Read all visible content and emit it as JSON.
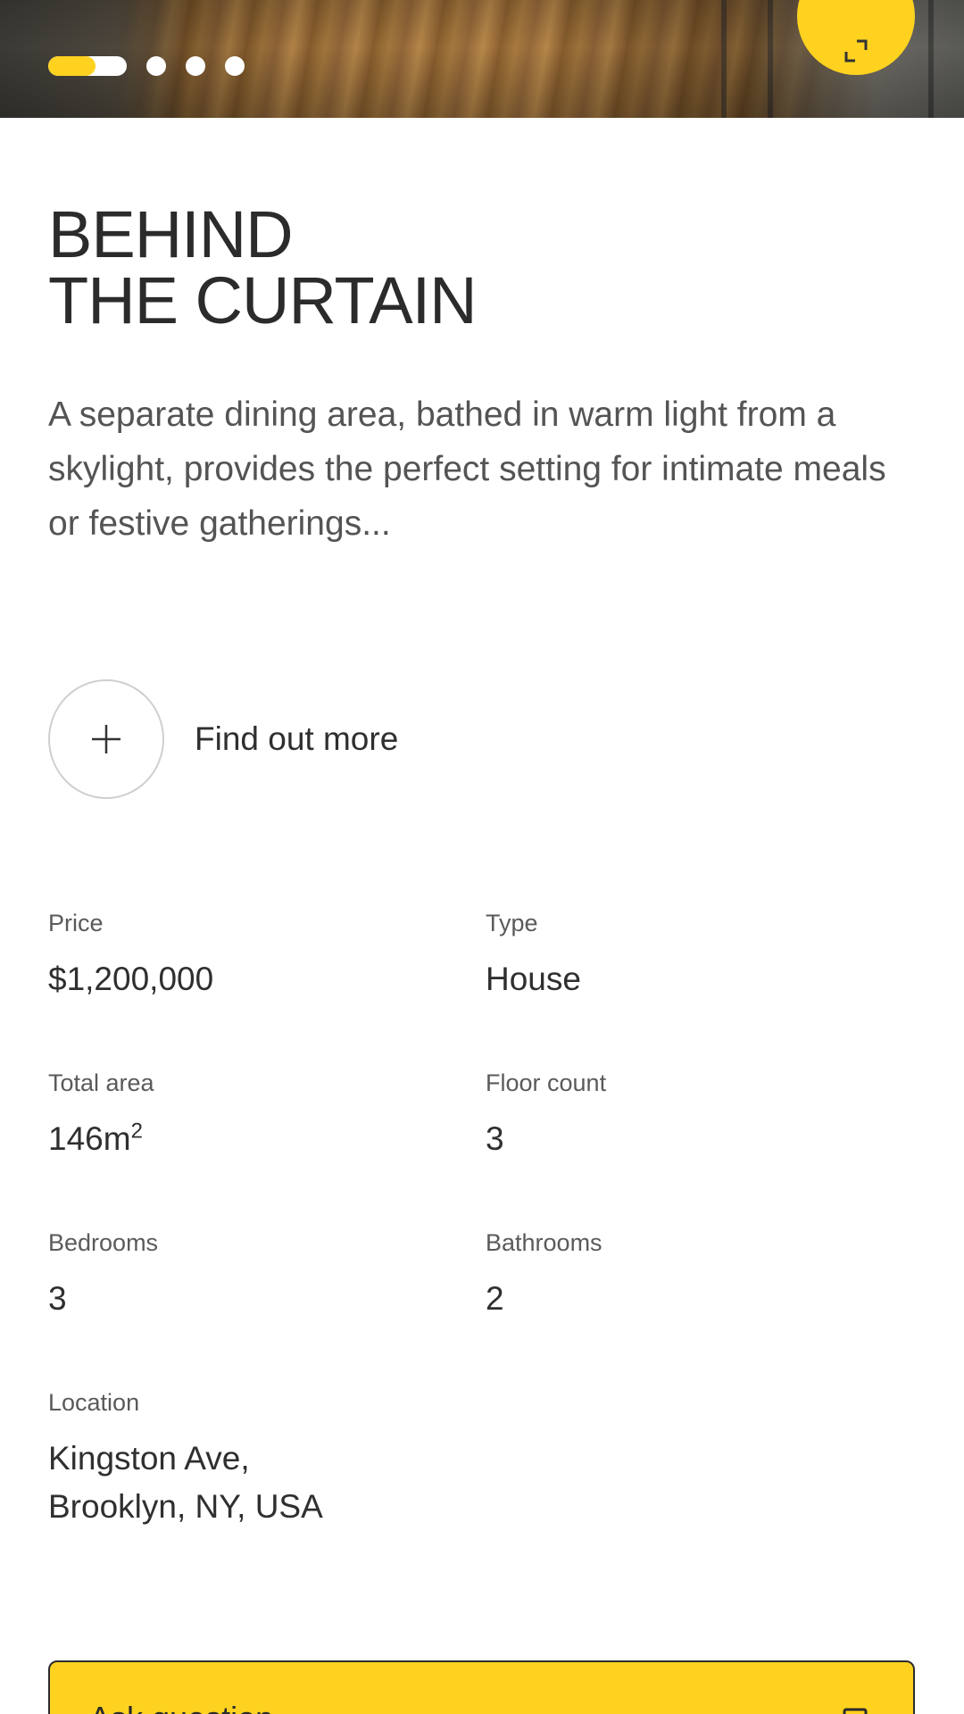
{
  "hero": {
    "carousel": {
      "total_slides": 4,
      "active_index": 0,
      "active_progress": 0.6
    },
    "expand_icon": "expand-icon",
    "accent_color": "#ffd21f"
  },
  "article": {
    "title_line1": "BEHIND",
    "title_line2": "THE CURTAIN",
    "description": "A separate dining area, bathed in warm light from a skylight, provides the perfect setting for intimate meals or festive gatherings..."
  },
  "find_more": {
    "icon": "plus-icon",
    "label": "Find out more"
  },
  "specs": {
    "price": {
      "label": "Price",
      "value": "$1,200,000"
    },
    "type": {
      "label": "Type",
      "value": "House"
    },
    "total_area": {
      "label": "Total area",
      "value": "146m",
      "unit_sup": "2"
    },
    "floor_count": {
      "label": "Floor count",
      "value": "3"
    },
    "bedrooms": {
      "label": "Bedrooms",
      "value": "3"
    },
    "bathrooms": {
      "label": "Bathrooms",
      "value": "2"
    },
    "location": {
      "label": "Location",
      "line1": "Kingston Ave,",
      "line2": "Brooklyn, NY, USA"
    }
  },
  "cta": {
    "label": "Ask question",
    "icon": "chat-icon"
  }
}
